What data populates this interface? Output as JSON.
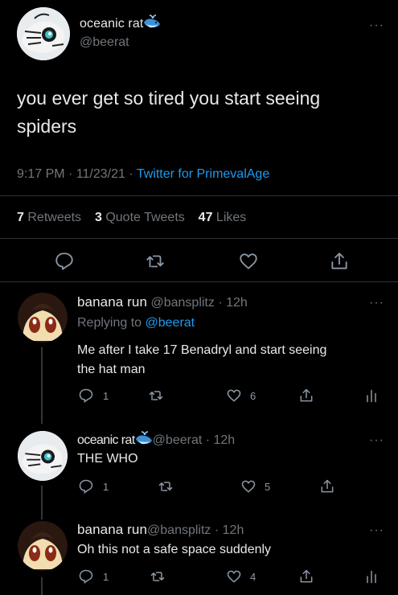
{
  "main_tweet": {
    "name": "oceanic rat",
    "handle": "@beerat",
    "text_line1": "you ever get so tired you start seeing",
    "text_line2": "spiders",
    "time": "9:17 PM · 11/23/21 · ",
    "source": "Twitter for PrimevalAge",
    "retweets_count": "7",
    "retweets_label": "Retweets",
    "quotes_count": "3",
    "quotes_label": "Quote Tweets",
    "likes_count": "47",
    "likes_label": "Likes"
  },
  "replies": [
    {
      "name": "banana run",
      "handle": "@bansplitz · 12h",
      "replying_prefix": "Replying to ",
      "replying_handle": "@beerat",
      "text_line1": "Me after I take 17 Benadryl and start seeing",
      "text_line2": "the hat man",
      "reply_count": "1",
      "like_count": "6"
    },
    {
      "name": "oceanic rat",
      "handle": "@beerat · 12h",
      "text_line1": "THE WHO",
      "reply_count": "1",
      "like_count": "5"
    },
    {
      "name": "banana run",
      "handle": "@bansplitz · 12h",
      "text_line1": "Oh this not a safe space suddenly",
      "reply_count": "1",
      "like_count": "4"
    }
  ],
  "more_glyph": "···",
  "colors": {
    "accent": "#1d9bf0",
    "background": "#000000",
    "muted": "#71767b"
  }
}
